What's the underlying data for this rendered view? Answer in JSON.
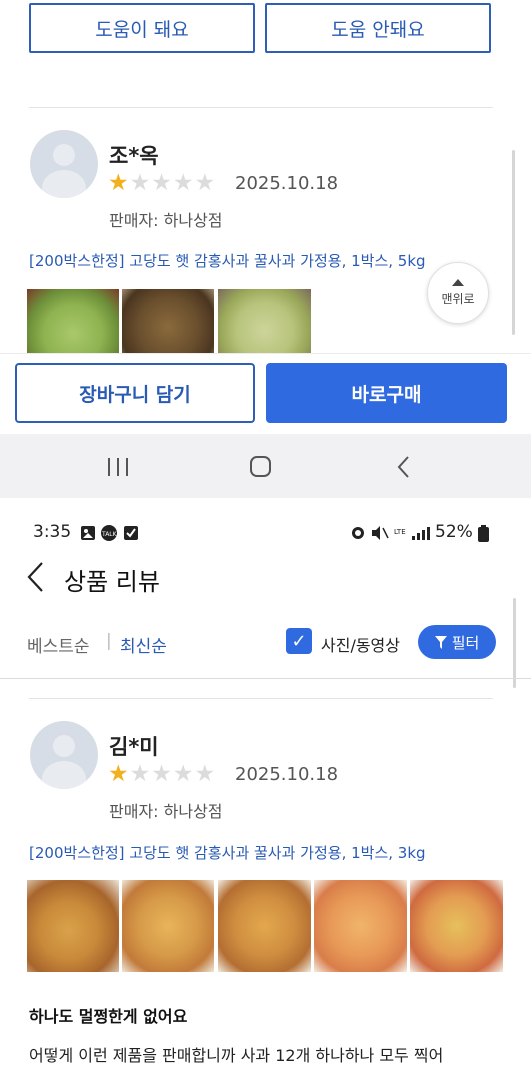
{
  "helpful": {
    "yes_label": "도움이 돼요",
    "no_label": "도움 안돼요"
  },
  "review1": {
    "name": "조*옥",
    "rating": 1,
    "date": "2025.10.18",
    "seller": "판매자: 하나상점",
    "product": "[200박스한정] 고당도 햇 감홍사과 꿀사과 가정용, 1박스, 5kg"
  },
  "scroll_top": {
    "label": "맨위로"
  },
  "bottom_actions": {
    "cart_label": "장바구니 담기",
    "buy_label": "바로구매"
  },
  "system_nav": {
    "recents_icon": "recents-icon",
    "home_icon": "home-icon",
    "back_icon": "back-icon"
  },
  "status_bar": {
    "time": "3:35",
    "battery": "52%"
  },
  "header": {
    "title": "상품 리뷰"
  },
  "sort": {
    "best_label": "베스트순",
    "separator": "|",
    "latest_label": "최신순",
    "photo_video_label": "사진/동영상",
    "photo_video_checked": true,
    "filter_label": "필터"
  },
  "review2": {
    "name": "김*미",
    "rating": 1,
    "date": "2025.10.18",
    "seller": "판매자: 하나상점",
    "product": "[200박스한정] 고당도 햇 감홍사과 꿀사과 가정용, 1박스, 3kg",
    "title": "하나도 멀쩡한게 없어요",
    "body": "어떻게 이런 제품을 판매합니까 사과 12개 하나하나 모두 찍어"
  },
  "colors": {
    "accent": "#2f6ae0",
    "star": "#f2b01e",
    "link": "#2a5bb4"
  }
}
